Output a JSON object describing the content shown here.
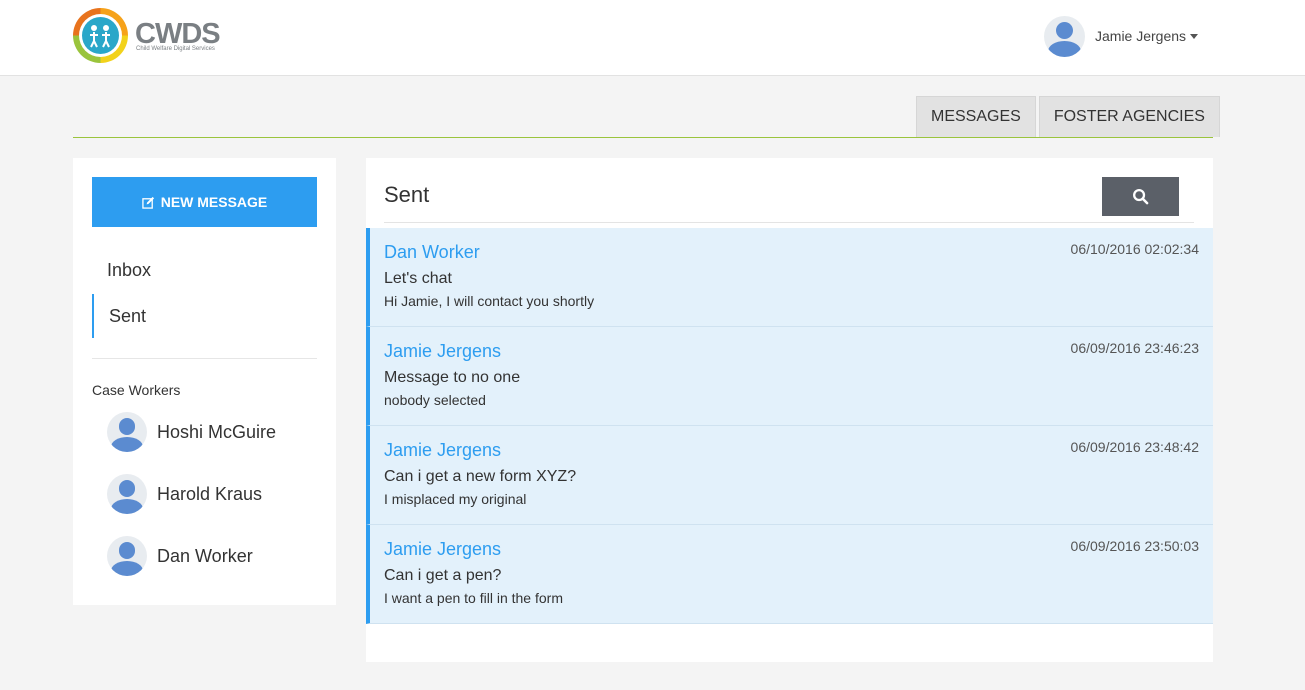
{
  "brand": {
    "name": "CWDS",
    "tagline": "Child Welfare Digital Services"
  },
  "user": {
    "name": "Jamie Jergens"
  },
  "tabs": [
    {
      "label": "MESSAGES"
    },
    {
      "label": "FOSTER AGENCIES"
    }
  ],
  "sidebar": {
    "new_message_label": "NEW MESSAGE",
    "folders": [
      {
        "label": "Inbox",
        "active": false
      },
      {
        "label": "Sent",
        "active": true
      }
    ],
    "case_workers_label": "Case Workers",
    "case_workers": [
      {
        "name": "Hoshi McGuire"
      },
      {
        "name": "Harold Kraus"
      },
      {
        "name": "Dan Worker"
      }
    ]
  },
  "main": {
    "title": "Sent",
    "messages": [
      {
        "sender": "Dan Worker",
        "timestamp": "06/10/2016 02:02:34",
        "subject": "Let's chat",
        "preview": "Hi Jamie, I will contact you shortly"
      },
      {
        "sender": "Jamie Jergens",
        "timestamp": "06/09/2016 23:46:23",
        "subject": "Message to no one",
        "preview": "nobody selected"
      },
      {
        "sender": "Jamie Jergens",
        "timestamp": "06/09/2016 23:48:42",
        "subject": "Can i get a new form XYZ?",
        "preview": "I misplaced my original"
      },
      {
        "sender": "Jamie Jergens",
        "timestamp": "06/09/2016 23:50:03",
        "subject": "Can i get a pen?",
        "preview": "I want a pen to fill in the form"
      }
    ]
  },
  "colors": {
    "accent": "#2d9df0",
    "tab_underline": "#9ac43c",
    "search_button": "#5b6068",
    "message_bg": "#e3f1fb"
  },
  "icons": {
    "new_message": "pencil-square-icon",
    "search": "search-icon",
    "caret": "caret-down-icon"
  }
}
